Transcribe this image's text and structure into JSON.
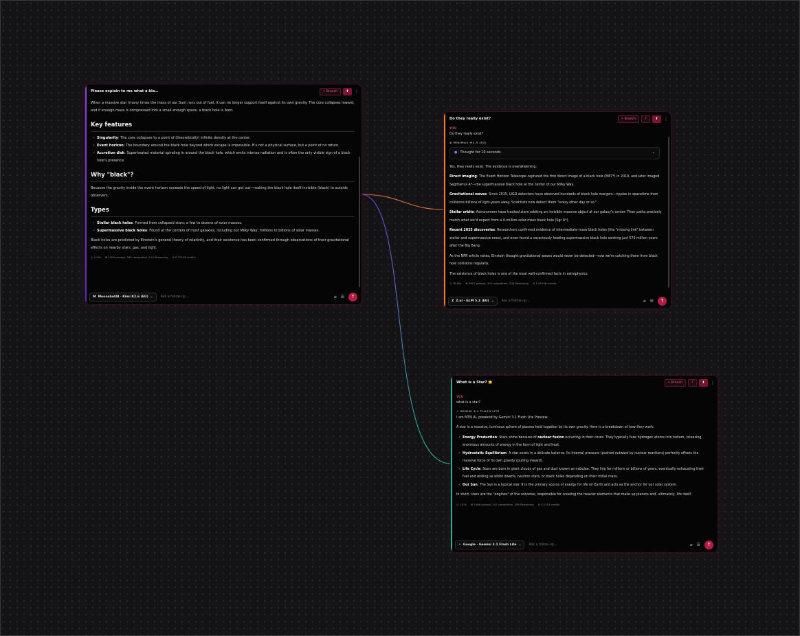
{
  "colors": {
    "accent_red": "#e0466a",
    "edge_purple": "#7b3fe4",
    "edge_orange": "#f07a3a",
    "edge_teal": "#1fb58f",
    "send_button": "#b41e44"
  },
  "card1": {
    "title": "Please explain to me what a bla…",
    "branch_label": "Branch",
    "intro": "When a massive star (many times the mass of our Sun) runs out of fuel, it can no longer support itself against its own gravity. The core collapses inward, and if enough mass is compressed into a small enough space, a black hole is born.",
    "h_key": "Key features",
    "features": [
      {
        "term": "Singularity",
        "text": ": The core collapses to a point of (theoretically) infinite density at the center."
      },
      {
        "term": "Event horizon",
        "text": ": The boundary around the black hole beyond which escape is impossible. It's not a physical surface, but a point of no return."
      },
      {
        "term": "Accretion disk",
        "text": ": Superheated material spiraling in around the black hole, which emits intense radiation and is often the only visible sign of a black hole's presence."
      }
    ],
    "h_why": "Why \"black\"?",
    "why_text": "Because the gravity inside the event horizon exceeds the speed of light, no light can get out—making the black hole itself invisible (black) to outside observers.",
    "h_types": "Types",
    "types": [
      {
        "term": "Stellar black holes",
        "text": ": Formed from collapsed stars; a few to dozens of solar masses."
      },
      {
        "term": "Supermassive black holes",
        "text": ": Found at the centers of most galaxies, including our Milky Way; millions to billions of solar masses."
      }
    ],
    "closing": "Black holes are predicted by Einstein's general theory of relativity, and their existence has been confirmed through observations of their gravitational effects on nearby stars, gas, and light.",
    "stats": {
      "time": "3.45s",
      "tokens": "1064 prompt, 280 completion, 114 Reasoning",
      "credits": "0.70196 credits"
    },
    "model": "MoonshotAI · Kimi K2.6 (EU)",
    "placeholder": "Ask a follow-up..."
  },
  "card2": {
    "title": "Do they really exist?",
    "branch_label": "Branch",
    "you_label": "YOU",
    "question": "Do they really exist?",
    "model_label": "MINIMAX M2.5 (EU)",
    "thought": "Thought for 10 seconds",
    "intro": "Yes, they really exist. The evidence is overwhelming:",
    "points": [
      {
        "term": "Direct imaging",
        "text": ": The Event Horizon Telescope captured the first direct image of a black hole (M87*) in 2019, and later imaged Sagittarius A*—the supermassive black hole at the center of our Milky Way."
      },
      {
        "term": "Gravitational waves",
        "text": ": Since 2015, LIGO detectors have observed hundreds of black hole mergers—ripples in spacetime from collisions billions of light-years away. Scientists now detect them \"every other day or so.\""
      },
      {
        "term": "Stellar orbits",
        "text": ": Astronomers have tracked stars orbiting an invisible massive object at our galaxy's center. Their paths precisely match what we'd expect from a 4-million-solar-mass black hole (Sgr A*)."
      },
      {
        "term": "Recent 2025 discoveries",
        "text": ": Researchers confirmed evidence of intermediate-mass black holes (the \"missing link\" between stellar and supermassive ones), and even found a voraciously feeding supermassive black hole existing just 570 million years after the Big Bang."
      }
    ],
    "npr": "As the NPR article notes, Einstein thought gravitational waves would never be detected—now we're catching them from black hole collisions regularly.",
    "closing": "The existence of black holes is one of the most well-confirmed facts in astrophysics.",
    "stats": {
      "time": "36.65s",
      "tokens": "3657 prompt, 305 completion, 206 Reasoning",
      "credits": "1.65346 credits"
    },
    "model": "Z.ai · GLM 5.2 (EU)",
    "placeholder": "Ask a follow-up..."
  },
  "card3": {
    "title": "What is a Star? 🌟",
    "branch_label": "Branch",
    "you_label": "YOU",
    "question": "what is a star?",
    "model_label": "GEMINI 3.1 FLASH LITE",
    "intro1": "I am MTN AI, powered by Gemini 3.1 Flash Lite Preview.",
    "intro2": "A star is a massive, luminous sphere of plasma held together by its own gravity. Here is a breakdown of how they work:",
    "points": [
      {
        "term": "Energy Production",
        "text": ": Stars shine because of ",
        "term2": "nuclear fusion",
        "text2": " occurring in their cores. They typically fuse hydrogen atoms into helium, releasing enormous amounts of energy in the form of light and heat."
      },
      {
        "term": "Hydrostatic Equilibrium",
        "text": ": A star exists in a delicate balance. Its internal pressure (pushed outward by nuclear reactions) perfectly offsets the massive force of its own gravity (pulling inward).",
        "term2": "",
        "text2": ""
      },
      {
        "term": "Life Cycle",
        "text": ": Stars are born in giant clouds of gas and dust known as nebulae. They live for millions or billions of years, eventually exhausting their fuel and ending as white dwarfs, neutron stars, or black holes depending on their initial mass.",
        "term2": "",
        "text2": ""
      },
      {
        "term": "Our Sun",
        "text": ": The Sun is a typical star. It is the primary source of energy for life on Earth and acts as the anchor for our solar system.",
        "term2": "",
        "text2": ""
      }
    ],
    "closing": "In short, stars are the \"engines\" of the universe, responsible for creating the heavier elements that make up planets and, ultimately, life itself.",
    "stats": {
      "time": "1.97s",
      "tokens": "1566 prompt, 241 completion, 206 Reasoning",
      "credits": "0.2114 credits"
    },
    "model": "Google · Gemini 3.1 Flash Lite",
    "placeholder": "Ask a follow-up..."
  }
}
